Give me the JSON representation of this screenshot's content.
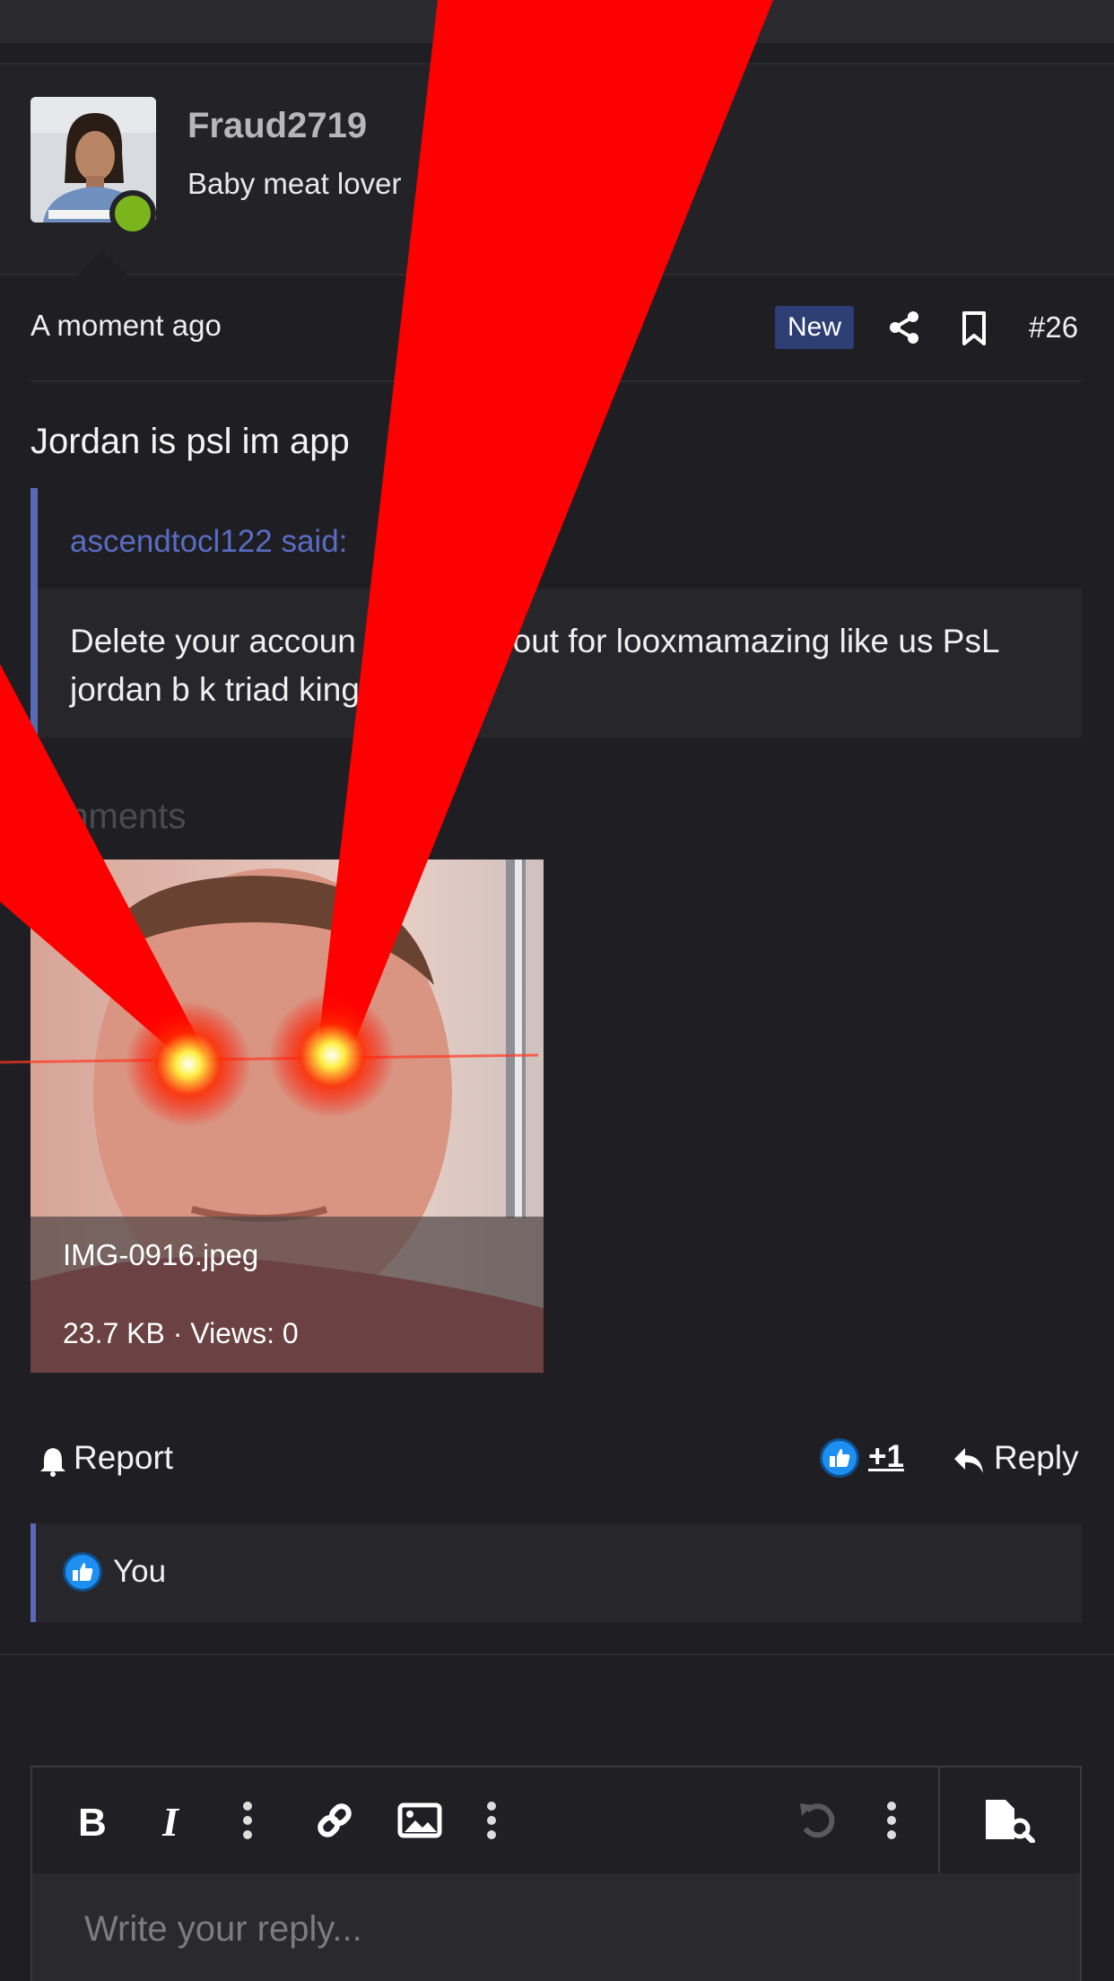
{
  "user": {
    "username": "Fraud2719",
    "title": "Baby meat lover",
    "online_color": "#7ab51d"
  },
  "post": {
    "time": "A moment ago",
    "badge": "New",
    "number": "#26",
    "text": "Jordan is psl im app",
    "icons": [
      "share-icon",
      "bookmark-icon"
    ]
  },
  "quote": {
    "author": "ascendtocl122 said:",
    "body": "Delete your accoun re not cut out for looxmamazing like us PsL jordan b k triad king"
  },
  "attachments": {
    "label": "achments",
    "file_name": "IMG-0916.jpeg",
    "file_meta": "23.7 KB · Views: 0"
  },
  "actions": {
    "report": "Report",
    "like_count": "+1",
    "reply": "Reply"
  },
  "reactions": {
    "user": "You"
  },
  "editor": {
    "placeholder": "Write your reply...",
    "tools": [
      "bold-icon",
      "italic-icon",
      "more-icon",
      "link-icon",
      "image-icon",
      "more-icon",
      "undo-icon",
      "more-icon",
      "preview-icon"
    ]
  },
  "colors": {
    "background": "#1f1f23",
    "accent": "#5869b6",
    "badge": "#2c3e73",
    "laser": "#ff0000"
  }
}
